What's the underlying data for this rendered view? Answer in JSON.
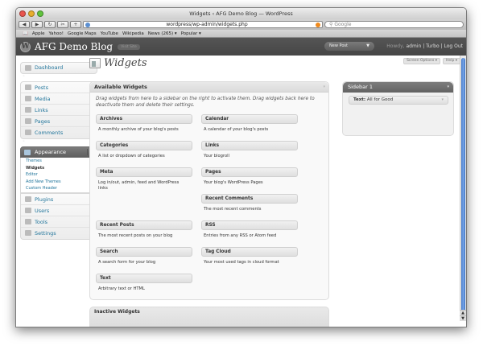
{
  "browser": {
    "window_title": "Widgets ‹ AFG Demo Blog — WordPress",
    "url": "wordpress/wp-admin/widgets.php",
    "search_placeholder": "Google",
    "bookmarks": [
      "Apple",
      "Yahoo!",
      "Google Maps",
      "YouTube",
      "Wikipedia",
      "News (265) ▾",
      "Popular ▾"
    ]
  },
  "wp_header": {
    "site_name": "AFG Demo Blog",
    "visit_site": "Visit Site",
    "new_post": "New Post",
    "howdy": "Howdy,",
    "user": "admin",
    "links": "| Turbo | Log Out"
  },
  "sidebar": {
    "dashboard": "Dashboard",
    "posts": "Posts",
    "media": "Media",
    "links": "Links",
    "pages": "Pages",
    "comments": "Comments",
    "appearance": "Appearance",
    "submenu": [
      "Themes",
      "Widgets",
      "Editor",
      "Add New Themes",
      "Custom Header"
    ],
    "plugins": "Plugins",
    "users": "Users",
    "tools": "Tools",
    "settings": "Settings"
  },
  "page": {
    "title": "Widgets",
    "screen_options": "Screen Options ▾",
    "help": "Help ▾"
  },
  "available": {
    "title": "Available Widgets",
    "description": "Drag widgets from here to a sidebar on the right to activate them. Drag widgets back here to deactivate them and delete their settings.",
    "widgets": [
      {
        "name": "Archives",
        "desc": "A monthly archive of your blog's posts"
      },
      {
        "name": "Calendar",
        "desc": "A calendar of your blog's posts"
      },
      {
        "name": "Categories",
        "desc": "A list or dropdown of categories"
      },
      {
        "name": "Links",
        "desc": "Your blogroll"
      },
      {
        "name": "Meta",
        "desc": "Log in/out, admin, feed and WordPress links"
      },
      {
        "name": "Pages",
        "desc": "Your blog's WordPress Pages"
      },
      {
        "name": "Recent Comments",
        "desc": "The most recent comments"
      },
      {
        "name": "Recent Posts",
        "desc": "The most recent posts on your blog"
      },
      {
        "name": "RSS",
        "desc": "Entries from any RSS or Atom feed"
      },
      {
        "name": "Search",
        "desc": "A search form for your blog"
      },
      {
        "name": "Tag Cloud",
        "desc": "Your most used tags in cloud format"
      },
      {
        "name": "Text",
        "desc": "Arbitrary text or HTML"
      }
    ]
  },
  "inactive": {
    "title": "Inactive Widgets"
  },
  "sidebar1": {
    "title": "Sidebar 1",
    "widget_type": "Text:",
    "widget_title": "All for Good"
  }
}
